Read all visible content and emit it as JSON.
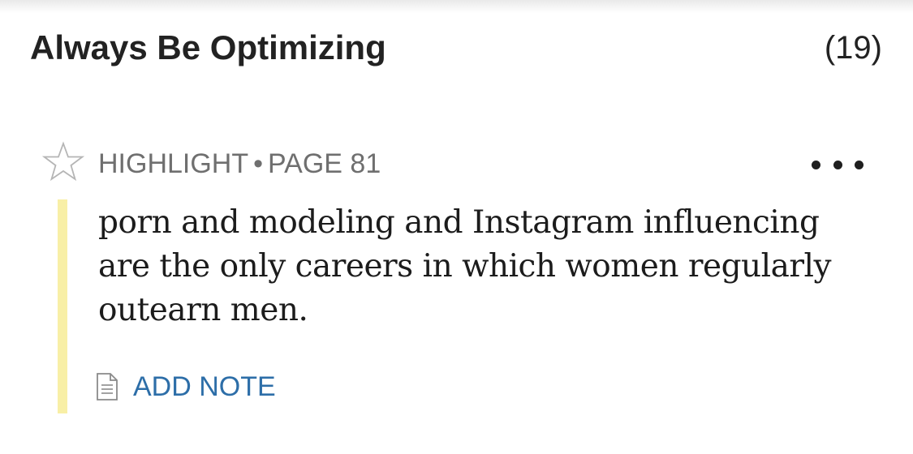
{
  "header": {
    "title": "Always Be Optimizing",
    "count": "(19)"
  },
  "highlight": {
    "type_label": "HIGHLIGHT",
    "separator": "•",
    "page_label": "PAGE 81",
    "text": "porn and modeling and Instagram influencing are the only careers in which women regularly outearn men.",
    "color": "#f8efa6"
  },
  "actions": {
    "add_note_label": "ADD NOTE",
    "star_icon": "star-outline-icon",
    "more_icon": "more-horizontal-icon",
    "note_icon": "document-icon"
  }
}
